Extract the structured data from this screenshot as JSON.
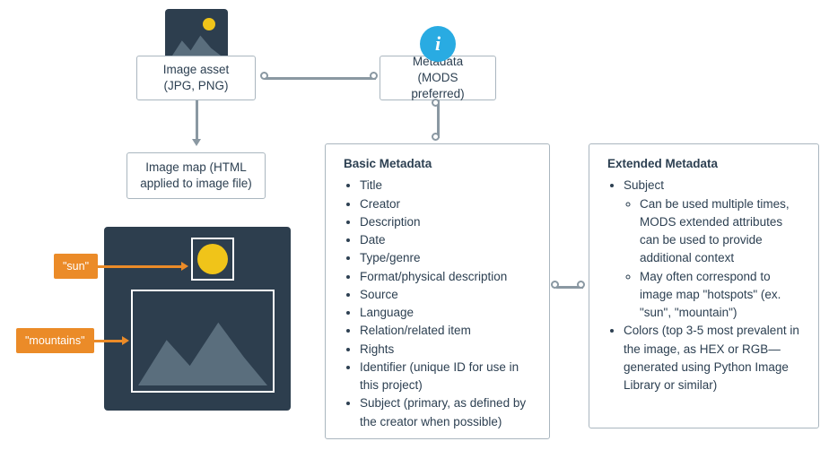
{
  "imageAsset": {
    "label": "Image asset (JPG, PNG)"
  },
  "metadataBox": {
    "label": "Metadata (MODS preferred)"
  },
  "imageMapBox": {
    "label": "Image map (HTML applied to image file)"
  },
  "tags": {
    "sun": "\"sun\"",
    "mountains": "\"mountains\""
  },
  "basic": {
    "title": "Basic Metadata",
    "items": [
      "Title",
      "Creator",
      "Description",
      "Date",
      "Type/genre",
      "Format/physical description",
      "Source",
      "Language",
      "Relation/related item",
      "Rights",
      "Identifier (unique ID for use in this project)",
      "Subject (primary, as defined by the creator when possible)"
    ]
  },
  "extended": {
    "title": "Extended Metadata",
    "items": [
      {
        "text": "Subject",
        "sub": [
          "Can be used multiple times, MODS extended attributes can be used to provide additional context",
          "May often correspond to image map \"hotspots\" (ex. \"sun\", \"mountain\")"
        ]
      },
      {
        "text": "Colors (top 3-5 most prevalent in the image, as HEX or RGB— generated using Python Image Library or similar)"
      }
    ]
  }
}
